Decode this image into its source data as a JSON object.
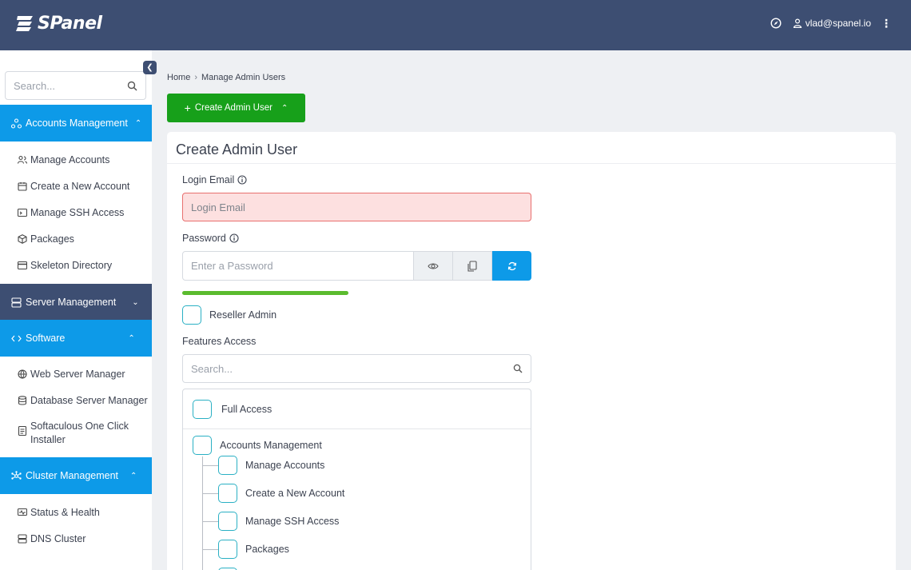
{
  "app": {
    "logo_text": "SPanel",
    "user_email": "vlad@spanel.io"
  },
  "sidebar": {
    "search_placeholder": "Search...",
    "sections": [
      {
        "label": "Accounts Management",
        "expanded": true,
        "style": "blue",
        "items": [
          "Manage Accounts",
          "Create a New Account",
          "Manage SSH Access",
          "Packages",
          "Skeleton Directory"
        ]
      },
      {
        "label": "Server Management",
        "expanded": false,
        "style": "dark",
        "items": []
      },
      {
        "label": "Software",
        "expanded": true,
        "style": "blue",
        "items": [
          "Web Server Manager",
          "Database Server Manager",
          "Softaculous One Click Installer"
        ]
      },
      {
        "label": "Cluster Management",
        "expanded": true,
        "style": "blue",
        "items": [
          "Status & Health",
          "DNS Cluster"
        ]
      }
    ]
  },
  "breadcrumb": {
    "home": "Home",
    "current": "Manage Admin Users"
  },
  "main": {
    "create_button": "Create Admin User",
    "card_title": "Create Admin User",
    "login_email_label": "Login Email",
    "login_email_placeholder": "Login Email",
    "password_label": "Password",
    "password_placeholder": "Enter a Password",
    "password_strength": 1.0,
    "reseller_label": "Reseller Admin",
    "features_label": "Features Access",
    "features_search_placeholder": "Search...",
    "features": {
      "full_access": "Full Access",
      "group": "Accounts Management",
      "children": [
        "Manage Accounts",
        "Create a New Account",
        "Manage SSH Access",
        "Packages"
      ]
    }
  },
  "colors": {
    "topbar": "#3d4e72",
    "accent_blue": "#0d9ae8",
    "create_green": "#17a01a",
    "error_bg": "#fde0e0",
    "strength_green": "#5bbb2e"
  }
}
